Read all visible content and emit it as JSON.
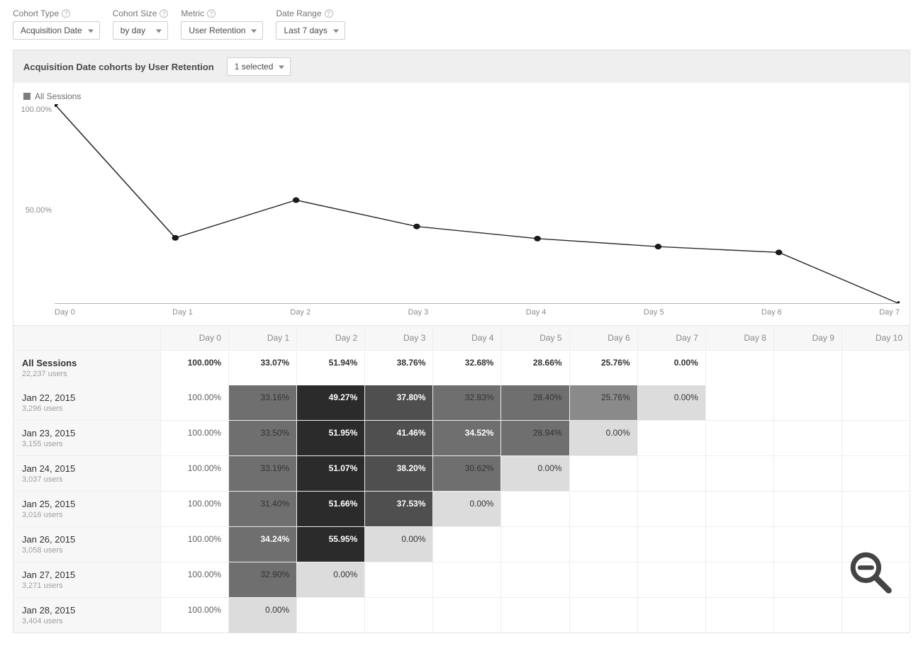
{
  "controls": {
    "cohort_type": {
      "label": "Cohort Type",
      "value": "Acquisition Date"
    },
    "cohort_size": {
      "label": "Cohort Size",
      "value": "by day"
    },
    "metric": {
      "label": "Metric",
      "value": "User Retention"
    },
    "date_range": {
      "label": "Date Range",
      "value": "Last 7 days"
    }
  },
  "panel": {
    "title": "Acquisition Date cohorts by User Retention",
    "selector_label": "1 selected"
  },
  "legend": {
    "series_name": "All Sessions"
  },
  "chart_data": {
    "type": "line",
    "title": "",
    "xlabel": "",
    "ylabel": "",
    "ylim": [
      0,
      100
    ],
    "ytick_labels": [
      "100.00%",
      "50.00%"
    ],
    "categories": [
      "Day 0",
      "Day 1",
      "Day 2",
      "Day 3",
      "Day 4",
      "Day 5",
      "Day 6",
      "Day 7"
    ],
    "series": [
      {
        "name": "All Sessions",
        "values": [
          100.0,
          33.07,
          51.94,
          38.76,
          32.68,
          28.66,
          25.76,
          0.0
        ]
      }
    ]
  },
  "table": {
    "headers": [
      "Day 0",
      "Day 1",
      "Day 2",
      "Day 3",
      "Day 4",
      "Day 5",
      "Day 6",
      "Day 7",
      "Day 8",
      "Day 9",
      "Day 10"
    ],
    "summary": {
      "label": "All Sessions",
      "sublabel": "22,237 users",
      "values": [
        "100.00%",
        "33.07%",
        "51.94%",
        "38.76%",
        "32.68%",
        "28.66%",
        "25.76%",
        "0.00%",
        "",
        "",
        ""
      ]
    },
    "rows": [
      {
        "label": "Jan 22, 2015",
        "sublabel": "3,296 users",
        "values": [
          "100.00%",
          "33.16%",
          "49.27%",
          "37.80%",
          "32.83%",
          "28.40%",
          "25.76%",
          "0.00%",
          "",
          "",
          ""
        ]
      },
      {
        "label": "Jan 23, 2015",
        "sublabel": "3,155 users",
        "values": [
          "100.00%",
          "33.50%",
          "51.95%",
          "41.46%",
          "34.52%",
          "28.94%",
          "0.00%",
          "",
          "",
          "",
          ""
        ]
      },
      {
        "label": "Jan 24, 2015",
        "sublabel": "3,037 users",
        "values": [
          "100.00%",
          "33.19%",
          "51.07%",
          "38.20%",
          "30.62%",
          "0.00%",
          "",
          "",
          "",
          "",
          ""
        ]
      },
      {
        "label": "Jan 25, 2015",
        "sublabel": "3,016 users",
        "values": [
          "100.00%",
          "31.40%",
          "51.66%",
          "37.53%",
          "0.00%",
          "",
          "",
          "",
          "",
          "",
          ""
        ]
      },
      {
        "label": "Jan 26, 2015",
        "sublabel": "3,058 users",
        "values": [
          "100.00%",
          "34.24%",
          "55.95%",
          "0.00%",
          "",
          "",
          "",
          "",
          "",
          "",
          ""
        ]
      },
      {
        "label": "Jan 27, 2015",
        "sublabel": "3,271 users",
        "values": [
          "100.00%",
          "32.90%",
          "0.00%",
          "",
          "",
          "",
          "",
          "",
          "",
          "",
          ""
        ]
      },
      {
        "label": "Jan 28, 2015",
        "sublabel": "3,404 users",
        "values": [
          "100.00%",
          "0.00%",
          "",
          "",
          "",
          "",
          "",
          "",
          "",
          "",
          ""
        ]
      }
    ]
  },
  "heat_palette": {
    "max": 56,
    "colors": [
      "#dcdcdc",
      "#adadad",
      "#8a8a8a",
      "#6f6f6f",
      "#4f4f4f",
      "#2b2b2b"
    ]
  }
}
